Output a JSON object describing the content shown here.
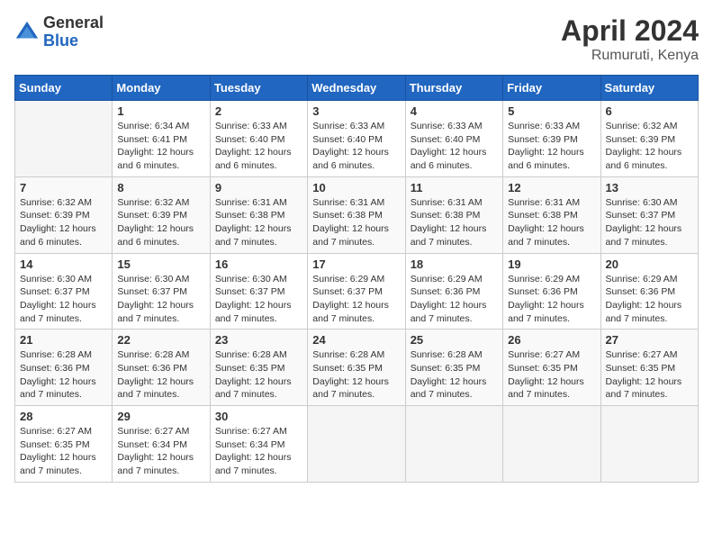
{
  "header": {
    "logo_general": "General",
    "logo_blue": "Blue",
    "title": "April 2024",
    "location": "Rumuruti, Kenya"
  },
  "calendar": {
    "days_of_week": [
      "Sunday",
      "Monday",
      "Tuesday",
      "Wednesday",
      "Thursday",
      "Friday",
      "Saturday"
    ],
    "weeks": [
      [
        {
          "day": "",
          "empty": true
        },
        {
          "day": "1",
          "sunrise": "6:34 AM",
          "sunset": "6:41 PM",
          "daylight": "12 hours and 6 minutes."
        },
        {
          "day": "2",
          "sunrise": "6:33 AM",
          "sunset": "6:40 PM",
          "daylight": "12 hours and 6 minutes."
        },
        {
          "day": "3",
          "sunrise": "6:33 AM",
          "sunset": "6:40 PM",
          "daylight": "12 hours and 6 minutes."
        },
        {
          "day": "4",
          "sunrise": "6:33 AM",
          "sunset": "6:40 PM",
          "daylight": "12 hours and 6 minutes."
        },
        {
          "day": "5",
          "sunrise": "6:33 AM",
          "sunset": "6:39 PM",
          "daylight": "12 hours and 6 minutes."
        },
        {
          "day": "6",
          "sunrise": "6:32 AM",
          "sunset": "6:39 PM",
          "daylight": "12 hours and 6 minutes."
        }
      ],
      [
        {
          "day": "7",
          "sunrise": "6:32 AM",
          "sunset": "6:39 PM",
          "daylight": "12 hours and 6 minutes."
        },
        {
          "day": "8",
          "sunrise": "6:32 AM",
          "sunset": "6:39 PM",
          "daylight": "12 hours and 6 minutes."
        },
        {
          "day": "9",
          "sunrise": "6:31 AM",
          "sunset": "6:38 PM",
          "daylight": "12 hours and 7 minutes."
        },
        {
          "day": "10",
          "sunrise": "6:31 AM",
          "sunset": "6:38 PM",
          "daylight": "12 hours and 7 minutes."
        },
        {
          "day": "11",
          "sunrise": "6:31 AM",
          "sunset": "6:38 PM",
          "daylight": "12 hours and 7 minutes."
        },
        {
          "day": "12",
          "sunrise": "6:31 AM",
          "sunset": "6:38 PM",
          "daylight": "12 hours and 7 minutes."
        },
        {
          "day": "13",
          "sunrise": "6:30 AM",
          "sunset": "6:37 PM",
          "daylight": "12 hours and 7 minutes."
        }
      ],
      [
        {
          "day": "14",
          "sunrise": "6:30 AM",
          "sunset": "6:37 PM",
          "daylight": "12 hours and 7 minutes."
        },
        {
          "day": "15",
          "sunrise": "6:30 AM",
          "sunset": "6:37 PM",
          "daylight": "12 hours and 7 minutes."
        },
        {
          "day": "16",
          "sunrise": "6:30 AM",
          "sunset": "6:37 PM",
          "daylight": "12 hours and 7 minutes."
        },
        {
          "day": "17",
          "sunrise": "6:29 AM",
          "sunset": "6:37 PM",
          "daylight": "12 hours and 7 minutes."
        },
        {
          "day": "18",
          "sunrise": "6:29 AM",
          "sunset": "6:36 PM",
          "daylight": "12 hours and 7 minutes."
        },
        {
          "day": "19",
          "sunrise": "6:29 AM",
          "sunset": "6:36 PM",
          "daylight": "12 hours and 7 minutes."
        },
        {
          "day": "20",
          "sunrise": "6:29 AM",
          "sunset": "6:36 PM",
          "daylight": "12 hours and 7 minutes."
        }
      ],
      [
        {
          "day": "21",
          "sunrise": "6:28 AM",
          "sunset": "6:36 PM",
          "daylight": "12 hours and 7 minutes."
        },
        {
          "day": "22",
          "sunrise": "6:28 AM",
          "sunset": "6:36 PM",
          "daylight": "12 hours and 7 minutes."
        },
        {
          "day": "23",
          "sunrise": "6:28 AM",
          "sunset": "6:35 PM",
          "daylight": "12 hours and 7 minutes."
        },
        {
          "day": "24",
          "sunrise": "6:28 AM",
          "sunset": "6:35 PM",
          "daylight": "12 hours and 7 minutes."
        },
        {
          "day": "25",
          "sunrise": "6:28 AM",
          "sunset": "6:35 PM",
          "daylight": "12 hours and 7 minutes."
        },
        {
          "day": "26",
          "sunrise": "6:27 AM",
          "sunset": "6:35 PM",
          "daylight": "12 hours and 7 minutes."
        },
        {
          "day": "27",
          "sunrise": "6:27 AM",
          "sunset": "6:35 PM",
          "daylight": "12 hours and 7 minutes."
        }
      ],
      [
        {
          "day": "28",
          "sunrise": "6:27 AM",
          "sunset": "6:35 PM",
          "daylight": "12 hours and 7 minutes."
        },
        {
          "day": "29",
          "sunrise": "6:27 AM",
          "sunset": "6:34 PM",
          "daylight": "12 hours and 7 minutes."
        },
        {
          "day": "30",
          "sunrise": "6:27 AM",
          "sunset": "6:34 PM",
          "daylight": "12 hours and 7 minutes."
        },
        {
          "day": "",
          "empty": true
        },
        {
          "day": "",
          "empty": true
        },
        {
          "day": "",
          "empty": true
        },
        {
          "day": "",
          "empty": true
        }
      ]
    ],
    "labels": {
      "sunrise": "Sunrise:",
      "sunset": "Sunset:",
      "daylight": "Daylight:"
    }
  }
}
